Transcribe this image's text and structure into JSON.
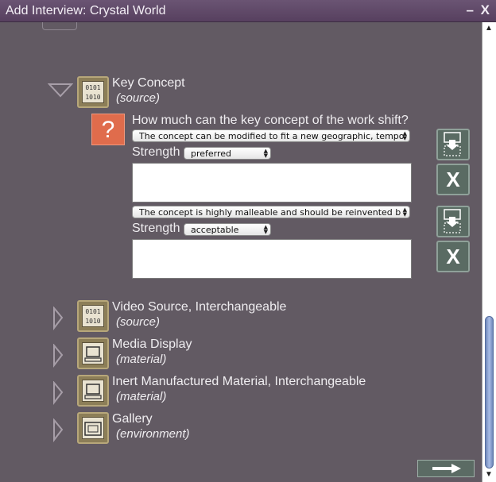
{
  "window": {
    "title": "Add Interview: Crystal World",
    "controls": "– X"
  },
  "tree": [
    {
      "name": "Key Concept",
      "type": "(source)",
      "icon": "binary-icon",
      "icon_text": "0101\n1010",
      "expanded": true
    },
    {
      "name": "Video Source, Interchangeable",
      "type": "(source)",
      "icon": "binary-icon",
      "icon_text": "0101\n1010",
      "expanded": false
    },
    {
      "name": "Media Display",
      "type": "(material)",
      "icon": "monitor-icon",
      "expanded": false
    },
    {
      "name": "Inert Manufactured Material, Interchangeable",
      "type": "(material)",
      "icon": "monitor-icon",
      "expanded": false
    },
    {
      "name": "Gallery",
      "type": "(environment)",
      "icon": "frame-icon",
      "expanded": false
    }
  ],
  "question": {
    "text": "How much can the key concept of the work shift?",
    "answers": [
      {
        "value": "The concept can be modified to fit a new geographic, tempo",
        "strength_label": "Strength",
        "strength": "preferred"
      },
      {
        "value": "The concept is highly malleable and should be reinvented b",
        "strength_label": "Strength",
        "strength": "acceptable"
      }
    ]
  },
  "buttons": {
    "remove": "X"
  },
  "colors": {
    "accent": "#e06c4c",
    "titlebar": "#5f4867",
    "background": "#625a63",
    "icon_bg": "#8c7e58",
    "button_bg": "#5a6b63"
  }
}
